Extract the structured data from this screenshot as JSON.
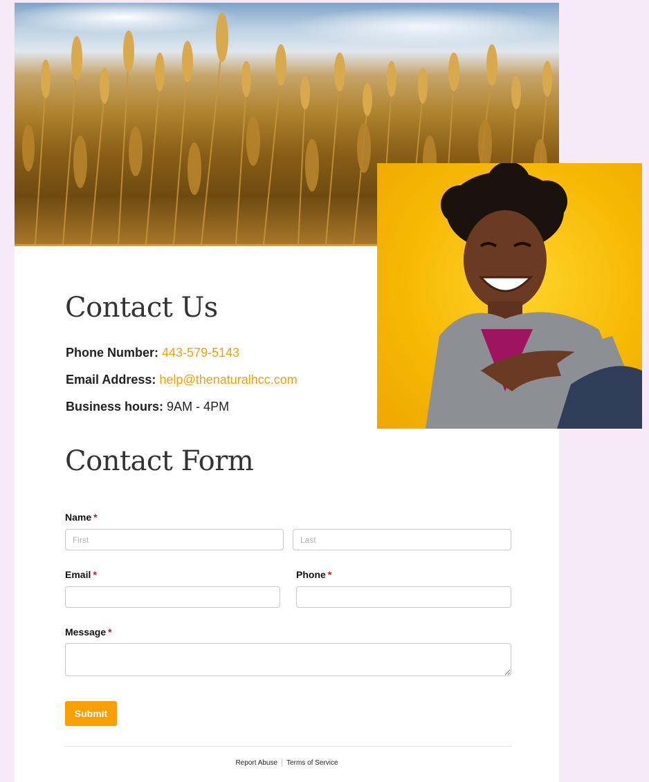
{
  "contact": {
    "heading": "Contact Us",
    "phone_label": "Phone Number:",
    "phone_value": "443-579-5143",
    "email_label": "Email Address:",
    "email_value": "help@thenaturalhcc.com",
    "hours_label": "Business hours:",
    "hours_value": "9AM - 4PM"
  },
  "form": {
    "heading": "Contact Form",
    "name_label": "Name",
    "required_mark": "*",
    "first_placeholder": "First",
    "last_placeholder": "Last",
    "email_label": "Email",
    "phone_label": "Phone",
    "message_label": "Message",
    "submit_label": "Submit"
  },
  "footer": {
    "report_abuse": "Report Abuse",
    "terms": "Terms of Service"
  },
  "colors": {
    "accent": "#f8a002",
    "link": "#f0a20b",
    "required": "#c0181b",
    "background": "#f6e9f8"
  }
}
